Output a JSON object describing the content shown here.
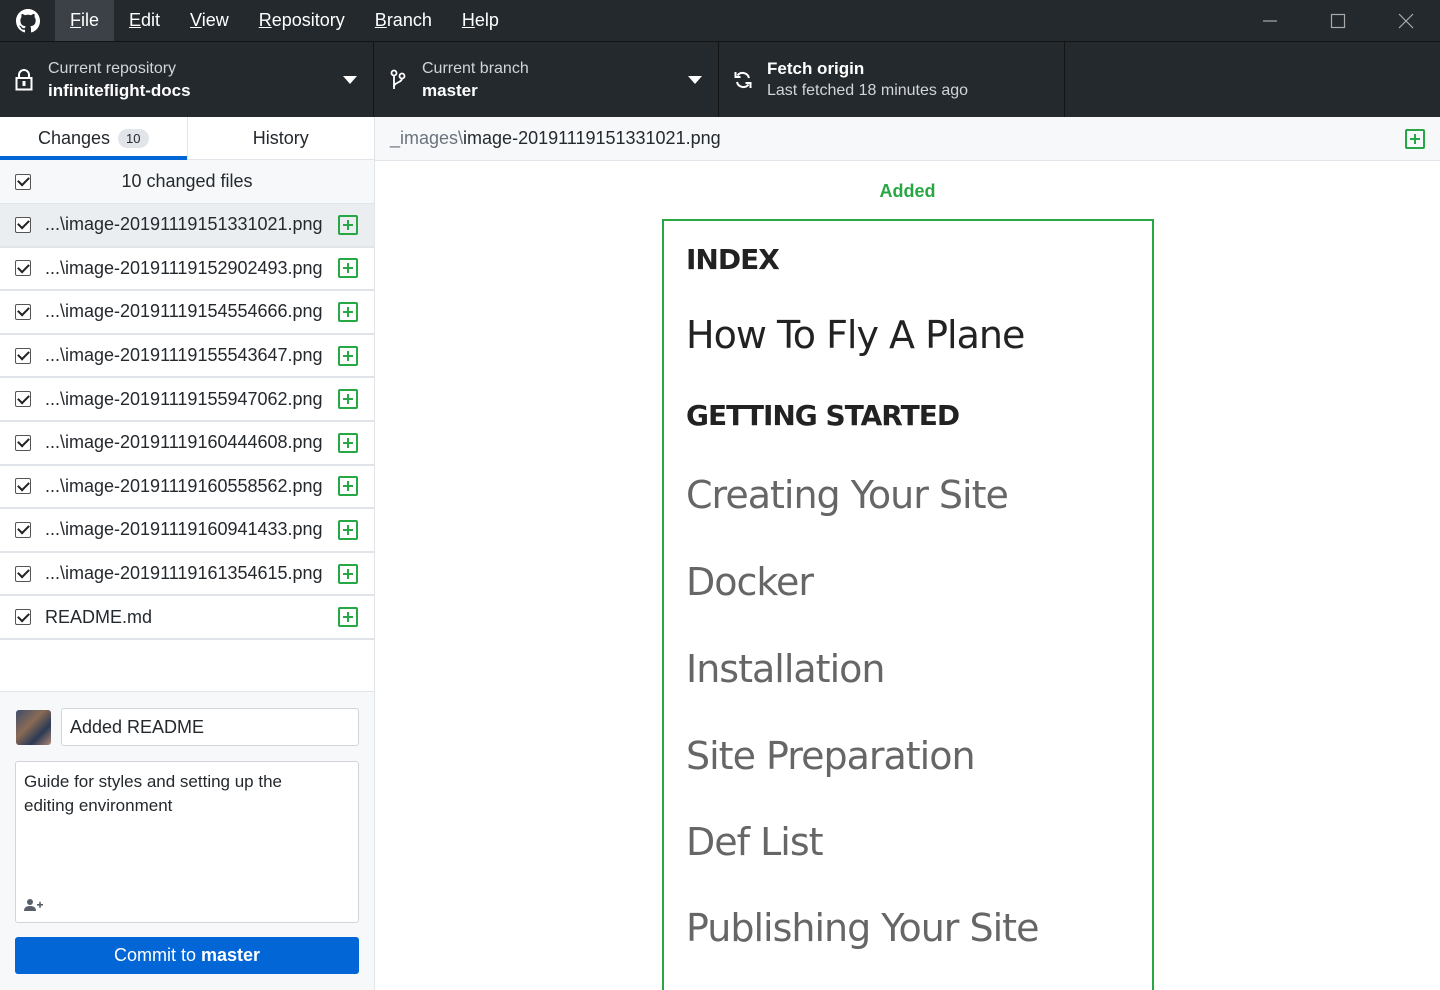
{
  "titlebar": {
    "menus": [
      {
        "prefix": "",
        "underline": "F",
        "rest": "ile"
      },
      {
        "prefix": "",
        "underline": "E",
        "rest": "dit"
      },
      {
        "prefix": "",
        "underline": "V",
        "rest": "iew"
      },
      {
        "prefix": "",
        "underline": "R",
        "rest": "epository"
      },
      {
        "prefix": "",
        "underline": "B",
        "rest": "ranch"
      },
      {
        "prefix": "",
        "underline": "H",
        "rest": "elp"
      }
    ]
  },
  "toolbar": {
    "repo": {
      "desc": "Current repository",
      "title": "infiniteflight-docs"
    },
    "branch": {
      "desc": "Current branch",
      "title": "master"
    },
    "fetch": {
      "title": "Fetch origin",
      "desc": "Last fetched 18 minutes ago"
    }
  },
  "tabs": {
    "changes": {
      "label": "Changes",
      "count": "10"
    },
    "history": {
      "label": "History"
    }
  },
  "files": {
    "count_label": "10 changed files",
    "items": [
      "...\\image-20191119151331021.png",
      "...\\image-20191119152902493.png",
      "...\\image-20191119154554666.png",
      "...\\image-20191119155543647.png",
      "...\\image-20191119155947062.png",
      "...\\image-20191119160444608.png",
      "...\\image-20191119160558562.png",
      "...\\image-20191119160941433.png",
      "...\\image-20191119161354615.png",
      "README.md"
    ]
  },
  "commit": {
    "summary": "Added README",
    "description_line1": "Guide for styles and setting up the",
    "description_line2": "editing environment",
    "button_prefix": "Commit to",
    "button_branch": "master"
  },
  "diff": {
    "path_dir": "_images\\",
    "path_file": "image-20191119151331021.png",
    "status": "Added",
    "preview": {
      "index": "INDEX",
      "title": "How To Fly A Plane",
      "section": "GETTING STARTED",
      "links": [
        "Creating Your Site",
        "Docker",
        "Installation",
        "Site Preparation",
        "Def List",
        "Publishing Your Site"
      ]
    }
  },
  "colors": {
    "titlebar_bg": "#24292e",
    "accent_blue": "#0366d6",
    "added_green": "#28a745"
  }
}
